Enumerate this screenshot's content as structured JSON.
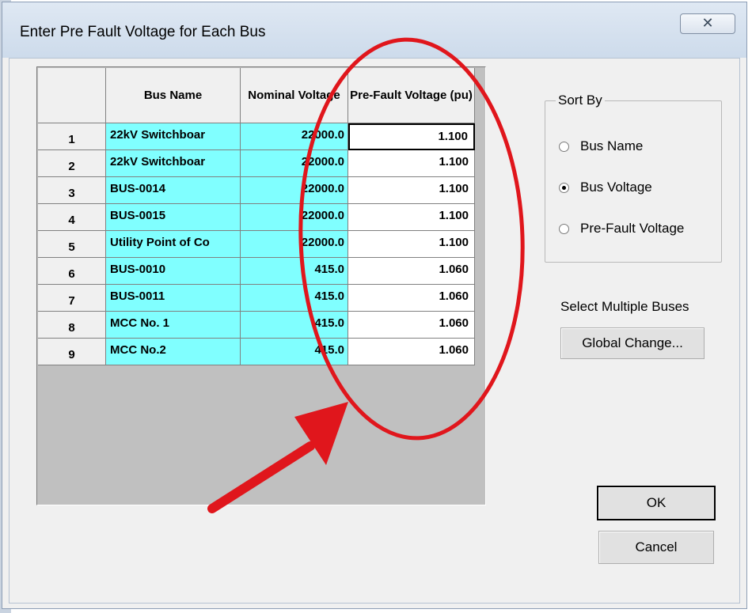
{
  "window": {
    "title": "Enter Pre Fault Voltage for Each Bus",
    "close_glyph": "✕"
  },
  "grid": {
    "headers": {
      "bus_name": "Bus Name",
      "nominal_voltage": "Nominal Voltage",
      "pre_fault_voltage": "Pre-Fault Voltage (pu)"
    },
    "rows": [
      {
        "num": "1",
        "bus_name": "22kV Switchboar",
        "nominal": "22000.0",
        "pre_fault": "1.100"
      },
      {
        "num": "2",
        "bus_name": "22kV Switchboar",
        "nominal": "22000.0",
        "pre_fault": "1.100"
      },
      {
        "num": "3",
        "bus_name": "BUS-0014",
        "nominal": "22000.0",
        "pre_fault": "1.100"
      },
      {
        "num": "4",
        "bus_name": "BUS-0015",
        "nominal": "22000.0",
        "pre_fault": "1.100"
      },
      {
        "num": "5",
        "bus_name": "Utility Point of Co",
        "nominal": "22000.0",
        "pre_fault": "1.100"
      },
      {
        "num": "6",
        "bus_name": "BUS-0010",
        "nominal": "415.0",
        "pre_fault": "1.060"
      },
      {
        "num": "7",
        "bus_name": "BUS-0011",
        "nominal": "415.0",
        "pre_fault": "1.060"
      },
      {
        "num": "8",
        "bus_name": "MCC No. 1",
        "nominal": "415.0",
        "pre_fault": "1.060"
      },
      {
        "num": "9",
        "bus_name": "MCC No.2",
        "nominal": "415.0",
        "pre_fault": "1.060"
      }
    ],
    "cell_color": "#80ffff"
  },
  "sort_by": {
    "legend": "Sort By",
    "options": [
      {
        "label": "Bus Name",
        "checked": false
      },
      {
        "label": "Bus Voltage",
        "checked": true
      },
      {
        "label": "Pre-Fault Voltage",
        "checked": false
      }
    ]
  },
  "multi": {
    "label": "Select Multiple Buses",
    "button": "Global Change..."
  },
  "actions": {
    "ok": "OK",
    "cancel": "Cancel"
  },
  "annotation_color": "#e0161c"
}
